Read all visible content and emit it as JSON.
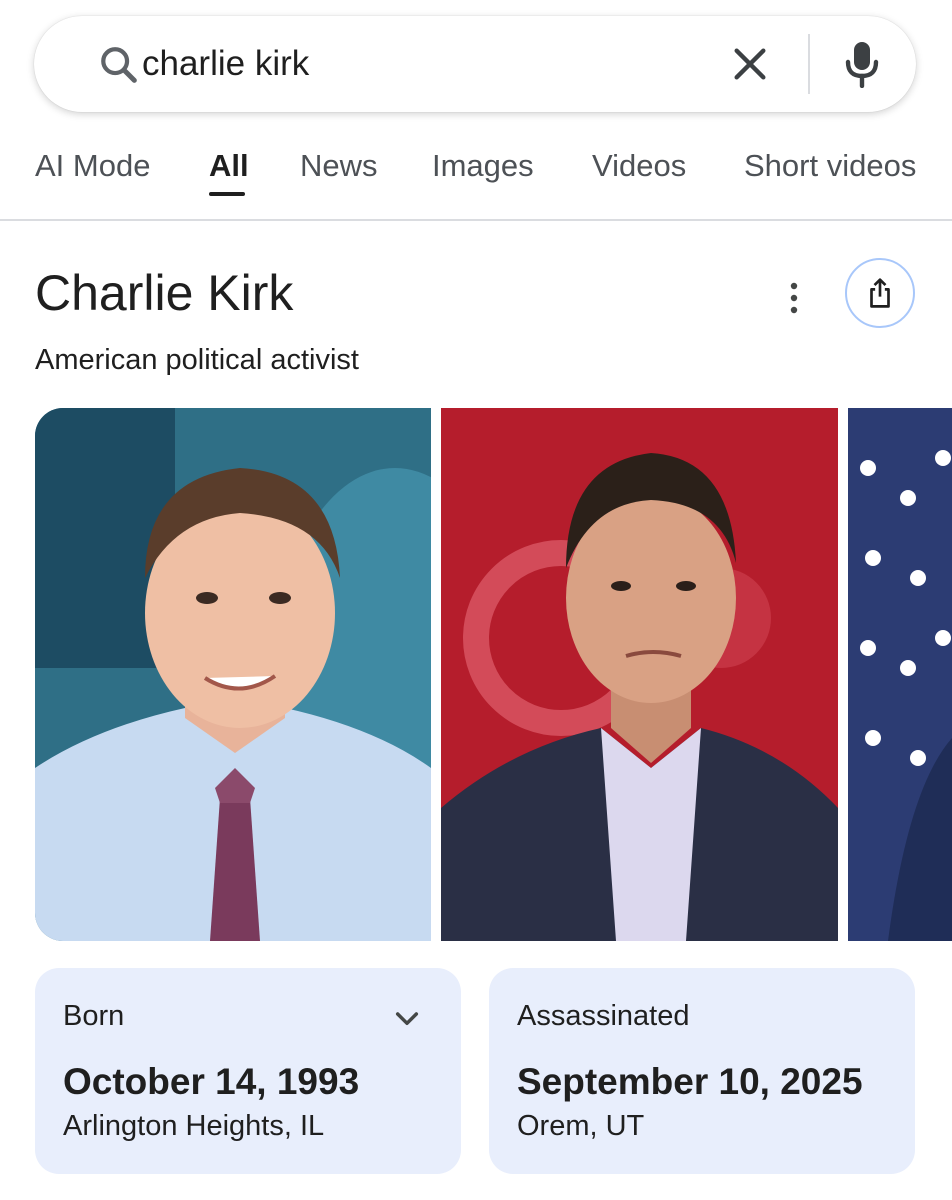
{
  "search": {
    "query": "charlie kirk"
  },
  "tabs": [
    {
      "label": "AI Mode"
    },
    {
      "label": "All"
    },
    {
      "label": "News"
    },
    {
      "label": "Images"
    },
    {
      "label": "Videos"
    },
    {
      "label": "Short videos"
    }
  ],
  "active_tab": "All",
  "knowledge_panel": {
    "title": "Charlie Kirk",
    "subtitle": "American political activist",
    "icons": [
      "more-vert-icon",
      "share-icon"
    ]
  },
  "facts": [
    {
      "label": "Born",
      "value": "October 14, 1993",
      "place": "Arlington Heights, IL",
      "expandable": true
    },
    {
      "label": "Assassinated",
      "value": "September 10, 2025",
      "place": "Orem, UT",
      "expandable": false
    }
  ],
  "colors": {
    "card_bg": "#e8eefc",
    "share_border": "#a8c7fa",
    "text": "#1f1f1f",
    "tab_inactive": "#4d5156"
  }
}
